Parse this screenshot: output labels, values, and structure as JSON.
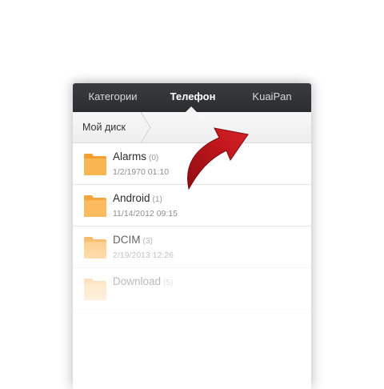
{
  "tabs": [
    {
      "label": "Категории",
      "active": false
    },
    {
      "label": "Телефон",
      "active": true
    },
    {
      "label": "KuaiPan",
      "active": false
    }
  ],
  "breadcrumb": {
    "label": "Мой диск"
  },
  "files": [
    {
      "name": "Alarms",
      "count": "(0)",
      "date": "1/2/1970 01:10",
      "icon": "folder-icon"
    },
    {
      "name": "Android",
      "count": "(1)",
      "date": "11/14/2012 09:15",
      "icon": "folder-icon"
    },
    {
      "name": "DCIM",
      "count": "(3)",
      "date": "2/19/2013 12:26",
      "icon": "folder-icon"
    },
    {
      "name": "Download",
      "count": "(5)",
      "date": "",
      "icon": "folder-icon"
    }
  ],
  "colors": {
    "tabbar": "#2f3134",
    "folder": "#f9ae4b",
    "arrow": "#c0161c"
  }
}
